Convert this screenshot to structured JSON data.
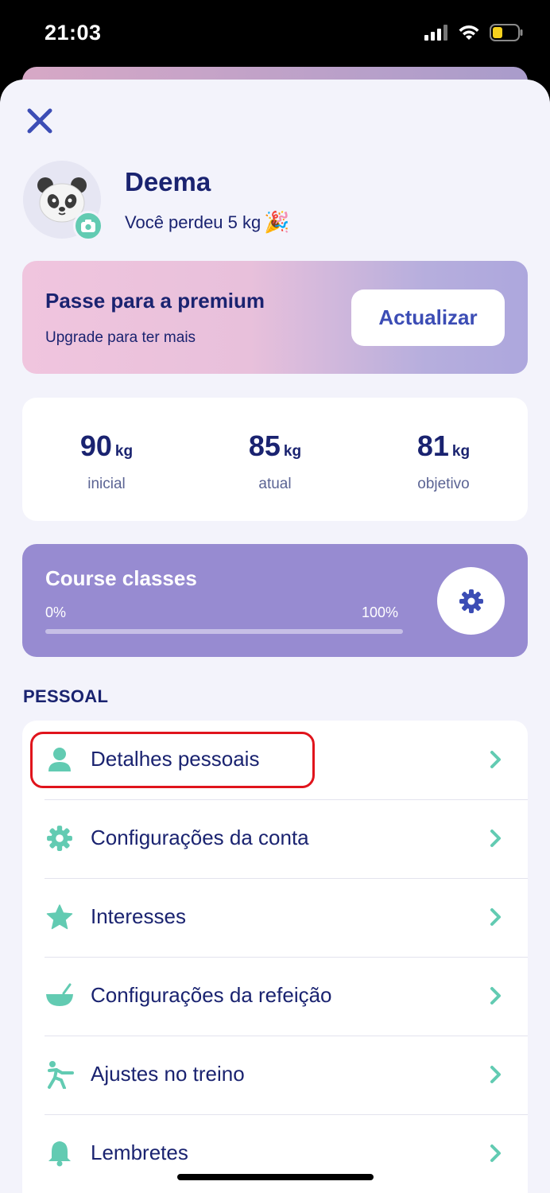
{
  "status_bar": {
    "time": "21:03",
    "battery_color": "#f7d21e"
  },
  "header": {
    "close_icon": "close-icon"
  },
  "profile": {
    "name": "Deema",
    "subtitle": "Você perdeu 5 kg",
    "avatar_icon": "panda-icon",
    "camera_icon": "camera-icon",
    "emoji": "🎉"
  },
  "premium": {
    "title": "Passe para a premium",
    "subtitle": "Upgrade para ter mais",
    "button_label": "Actualizar"
  },
  "stats": [
    {
      "value": "90",
      "unit": "kg",
      "label": "inicial"
    },
    {
      "value": "85",
      "unit": "kg",
      "label": "atual"
    },
    {
      "value": "81",
      "unit": "kg",
      "label": "objetivo"
    }
  ],
  "course": {
    "title": "Course classes",
    "min_label": "0%",
    "max_label": "100%",
    "progress": 0,
    "gear_icon": "gear-icon"
  },
  "section": {
    "label": "PESSOAL"
  },
  "menu": [
    {
      "label": "Detalhes pessoais",
      "icon": "person-icon"
    },
    {
      "label": "Configurações da conta",
      "icon": "gear-icon"
    },
    {
      "label": "Interesses",
      "icon": "star-icon"
    },
    {
      "label": "Configurações da refeição",
      "icon": "bowl-icon"
    },
    {
      "label": "Ajustes no treino",
      "icon": "exercise-icon"
    },
    {
      "label": "Lembretes",
      "icon": "bell-icon"
    }
  ],
  "colors": {
    "primary_text": "#1a2370",
    "accent_green": "#62cbb2",
    "course_purple": "#978bd1",
    "button_text": "#3c4db5",
    "highlight_red": "#e0141c"
  }
}
